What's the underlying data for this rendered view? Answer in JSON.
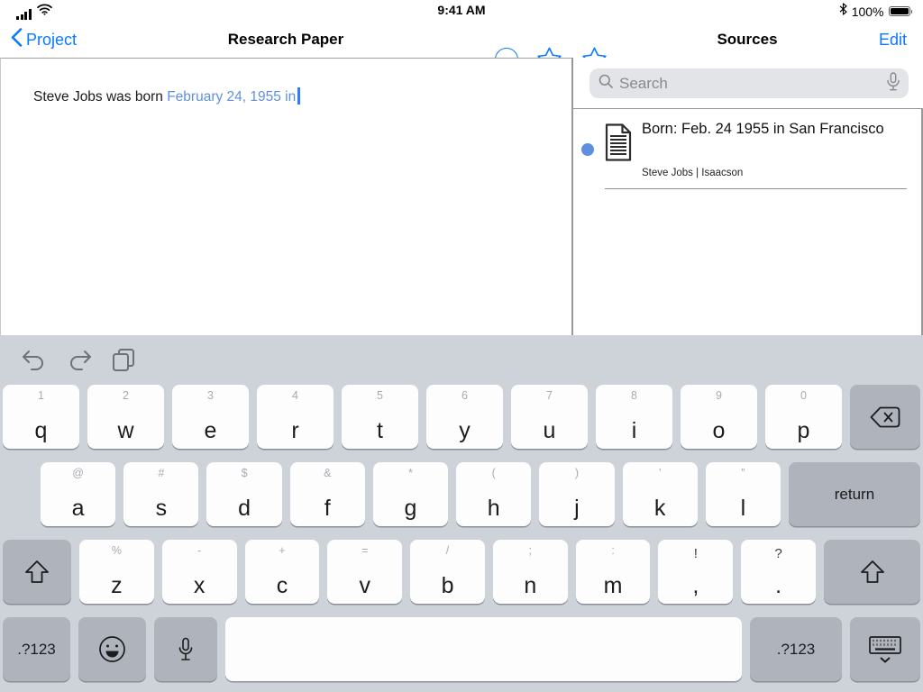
{
  "status_bar": {
    "time": "9:41 AM",
    "battery_percent": "100%"
  },
  "nav": {
    "back_label": "Project",
    "document_title": "Research Paper",
    "sources_title": "Sources",
    "edit_label": "Edit"
  },
  "editor": {
    "text_plain": "Steve Jobs was born ",
    "text_citation": "February 24, 1955 in"
  },
  "sources": {
    "search_placeholder": "Search",
    "items": [
      {
        "title": "Born: Feb. 24 1955 in San Francisco",
        "subtitle": "Steve Jobs | Isaacson"
      }
    ]
  },
  "colors": {
    "accent_blue": "#0a7aff",
    "citation_blue": "#5f8fe3",
    "source_dot_blue": "#5e8fe0",
    "keyboard_bg": "#ced2d9",
    "special_key": "#aeb3bc"
  },
  "keyboard": {
    "toolbar_icons": [
      "undo",
      "redo",
      "paste"
    ],
    "row1": [
      {
        "main": "q",
        "alt": "1"
      },
      {
        "main": "w",
        "alt": "2"
      },
      {
        "main": "e",
        "alt": "3"
      },
      {
        "main": "r",
        "alt": "4"
      },
      {
        "main": "t",
        "alt": "5"
      },
      {
        "main": "y",
        "alt": "6"
      },
      {
        "main": "u",
        "alt": "7"
      },
      {
        "main": "i",
        "alt": "8"
      },
      {
        "main": "o",
        "alt": "9"
      },
      {
        "main": "p",
        "alt": "0"
      },
      {
        "icon": "backspace",
        "type": "special",
        "cls": "backspace",
        "name": "backspace-key"
      }
    ],
    "row2": [
      {
        "main": "a",
        "alt": "@"
      },
      {
        "main": "s",
        "alt": "#"
      },
      {
        "main": "d",
        "alt": "$"
      },
      {
        "main": "f",
        "alt": "&"
      },
      {
        "main": "g",
        "alt": "*"
      },
      {
        "main": "h",
        "alt": "("
      },
      {
        "main": "j",
        "alt": ")"
      },
      {
        "main": "k",
        "alt": "’"
      },
      {
        "main": "l",
        "alt": "”"
      },
      {
        "label": "return",
        "type": "special",
        "cls": "return",
        "name": "return-key"
      }
    ],
    "row3": [
      {
        "icon": "shift",
        "type": "special",
        "cls": "shift",
        "name": "shift-key-left"
      },
      {
        "main": "z",
        "alt": "%"
      },
      {
        "main": "x",
        "alt": "-"
      },
      {
        "main": "c",
        "alt": "+"
      },
      {
        "main": "v",
        "alt": "="
      },
      {
        "main": "b",
        "alt": "/"
      },
      {
        "main": "n",
        "alt": ";"
      },
      {
        "main": "m",
        "alt": ":"
      },
      {
        "main": ",",
        "alt": "!",
        "dark": true,
        "name": "comma-exclamation-key"
      },
      {
        "main": ".",
        "alt": "?",
        "dark": true,
        "name": "period-question-key"
      },
      {
        "icon": "shift",
        "type": "special",
        "cls": "shift-r",
        "name": "shift-key-right"
      }
    ],
    "row4": [
      {
        "label": ".?123",
        "type": "special",
        "cls": "mode",
        "name": "numbers-key-left"
      },
      {
        "icon": "emoji",
        "type": "special",
        "cls": "emoji",
        "name": "emoji-key"
      },
      {
        "icon": "mic",
        "type": "special",
        "cls": "mic",
        "name": "dictation-key"
      },
      {
        "type": "space",
        "cls": "space",
        "name": "space-key"
      },
      {
        "label": ".?123",
        "type": "special",
        "cls": "mode-r",
        "name": "numbers-key-right"
      },
      {
        "icon": "dismiss",
        "type": "special",
        "cls": "dismiss",
        "name": "dismiss-keyboard-key"
      }
    ]
  }
}
